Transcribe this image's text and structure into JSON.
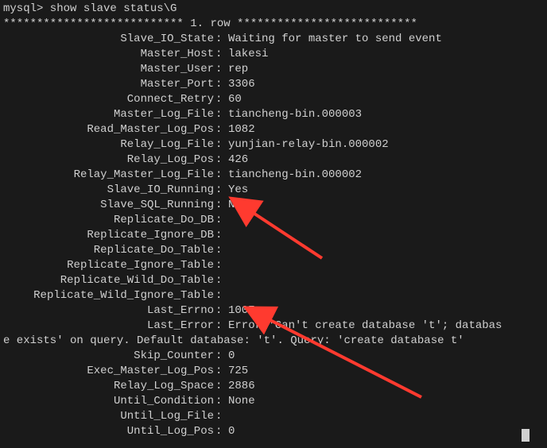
{
  "prompt": "mysql> show slave status\\G",
  "row_header": "*************************** 1. row ***************************",
  "fields": [
    {
      "label": "Slave_IO_State",
      "value": "Waiting for master to send event"
    },
    {
      "label": "Master_Host",
      "value": "lakesi"
    },
    {
      "label": "Master_User",
      "value": "rep"
    },
    {
      "label": "Master_Port",
      "value": "3306"
    },
    {
      "label": "Connect_Retry",
      "value": "60"
    },
    {
      "label": "Master_Log_File",
      "value": "tiancheng-bin.000003"
    },
    {
      "label": "Read_Master_Log_Pos",
      "value": "1082"
    },
    {
      "label": "Relay_Log_File",
      "value": "yunjian-relay-bin.000002"
    },
    {
      "label": "Relay_Log_Pos",
      "value": "426"
    },
    {
      "label": "Relay_Master_Log_File",
      "value": "tiancheng-bin.000002"
    },
    {
      "label": "Slave_IO_Running",
      "value": "Yes"
    },
    {
      "label": "Slave_SQL_Running",
      "value": "No"
    },
    {
      "label": "Replicate_Do_DB",
      "value": ""
    },
    {
      "label": "Replicate_Ignore_DB",
      "value": ""
    },
    {
      "label": "Replicate_Do_Table",
      "value": ""
    },
    {
      "label": "Replicate_Ignore_Table",
      "value": ""
    },
    {
      "label": "Replicate_Wild_Do_Table",
      "value": ""
    },
    {
      "label": "Replicate_Wild_Ignore_Table",
      "value": ""
    },
    {
      "label": "Last_Errno",
      "value": "1007"
    },
    {
      "label": "Last_Error",
      "value": "Error 'Can't create database 't'; database exists' on query. Default database: 't'. Query: 'create database t'"
    },
    {
      "label": "Skip_Counter",
      "value": "0"
    },
    {
      "label": "Exec_Master_Log_Pos",
      "value": "725"
    },
    {
      "label": "Relay_Log_Space",
      "value": "2886"
    },
    {
      "label": "Until_Condition",
      "value": "None"
    },
    {
      "label": "Until_Log_File",
      "value": ""
    },
    {
      "label": "Until_Log_Pos",
      "value": "0"
    }
  ],
  "last_error_line1": "Error 'Can't create database 't'; databas",
  "last_error_line2": "e exists' on query. Default database: 't'. Query: 'create database t'",
  "arrow_color": "#ff3a2f"
}
